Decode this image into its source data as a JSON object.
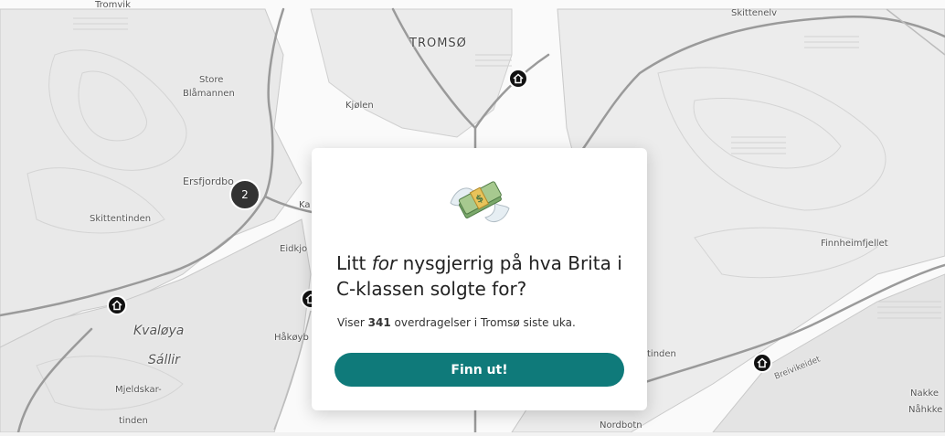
{
  "map": {
    "labels": {
      "tromso": "TROMSØ",
      "skittenelv": "Skittenelv",
      "store": "Store",
      "blamannen": "Blåmannen",
      "kjolen": "Kjølen",
      "ersfjordbotn": "Ersfjordbo",
      "skittentinden": "Skittentinden",
      "ka": "Ka",
      "eidkjo": "Eidkjo",
      "finnheimfjellet": "Finnheimfjellet",
      "kvaloya": "Kvaløya",
      "sallir": "Sállir",
      "hakoyb": "Håkøyb",
      "mjeldskar": "Mjeldskar-",
      "tinden_left": "tinden",
      "tinden_mid": "tinden",
      "nordbotn": "Nordbotn",
      "breivikeidet": "Breivikeidet",
      "nakke1": "Nakke",
      "nakke2": "Nåhkke",
      "tromvik": "Tromvik"
    },
    "cluster_count": "2",
    "colors": {
      "water": "#ffffff",
      "land": "#ececec",
      "road": "#9a9a9a",
      "pin": "#111111"
    }
  },
  "modal": {
    "emoji": "money-with-wings",
    "title_pre": "Litt ",
    "title_em": "for",
    "title_post": " nysgjerrig på hva Brita i C-klassen solgte for?",
    "sub_pre": "Viser ",
    "sub_count": "341",
    "sub_post": " overdragelser i Tromsø siste uka.",
    "cta_label": "Finn ut!",
    "accent": "#0f7a7a"
  }
}
